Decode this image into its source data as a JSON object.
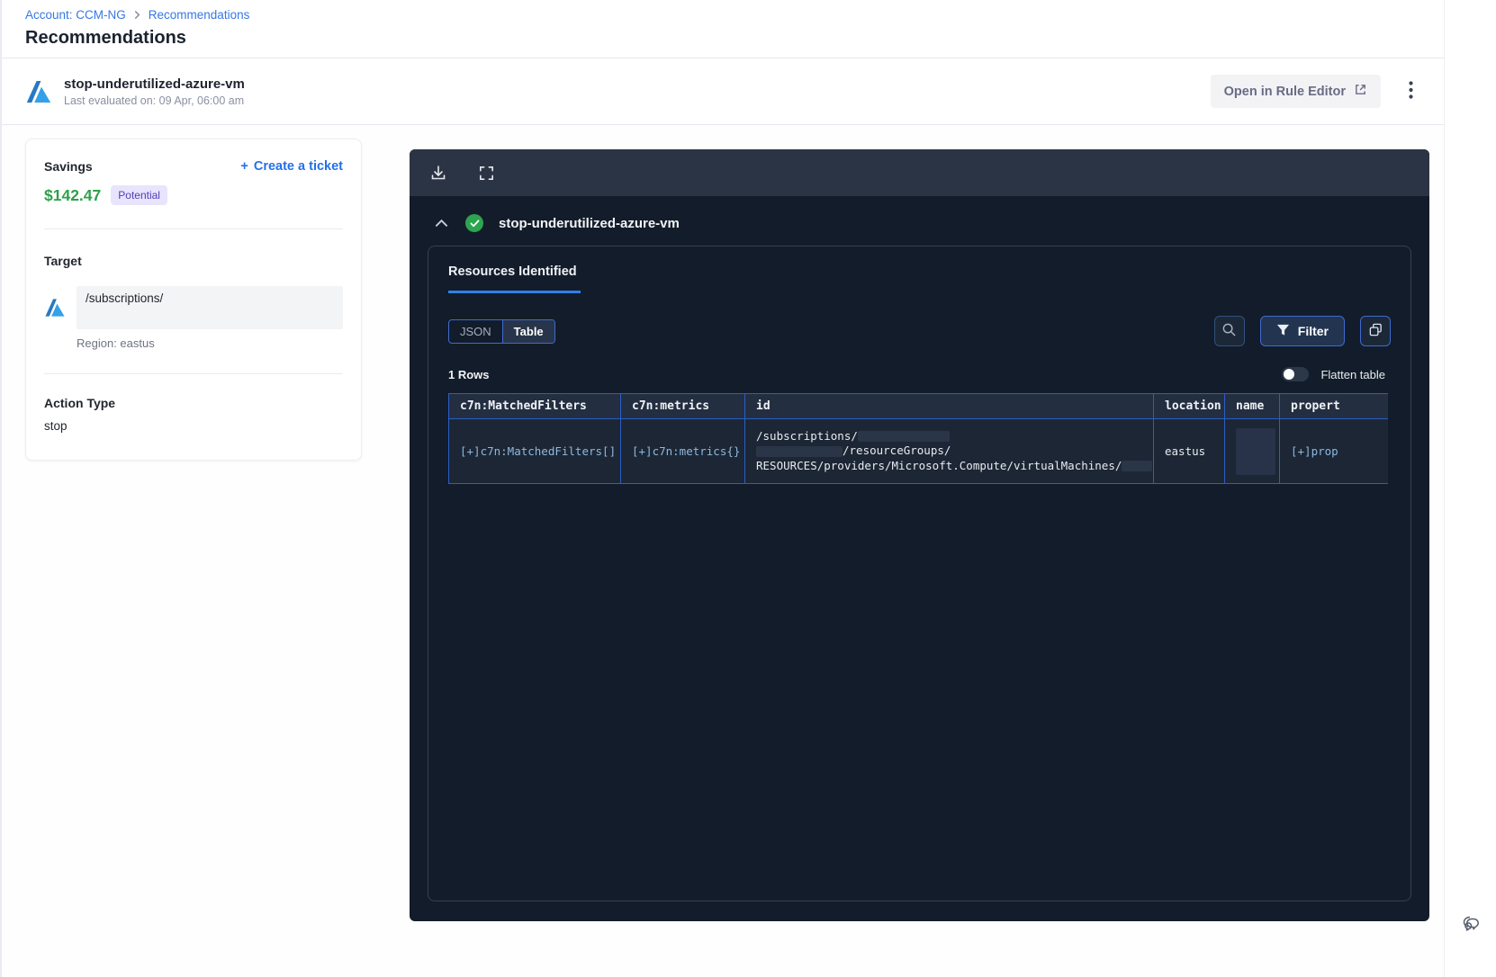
{
  "breadcrumb": {
    "account": "Account: CCM-NG",
    "separator": "›",
    "current": "Recommendations"
  },
  "page": {
    "title": "Recommendations"
  },
  "rule_header": {
    "name": "stop-underutilized-azure-vm",
    "last_evaluated": "Last evaluated on: 09 Apr, 06:00 am",
    "open_in_rule_editor": "Open in Rule Editor"
  },
  "savings_card": {
    "savings_label": "Savings",
    "amount": "$142.47",
    "badge": "Potential",
    "create_ticket": "Create a ticket",
    "plus_glyph": "+",
    "target_label": "Target",
    "target_path": "/subscriptions/",
    "region": "Region: eastus",
    "action_type_label": "Action Type",
    "action_type_value": "stop"
  },
  "viewer": {
    "section_title": "stop-underutilized-azure-vm",
    "tab_label": "Resources Identified",
    "view_toggle": {
      "json": "JSON",
      "table": "Table"
    },
    "filter_label": "Filter",
    "rows_count": "1 Rows",
    "flatten_label": "Flatten table",
    "table": {
      "columns": [
        "c7n:MatchedFilters",
        "c7n:metrics",
        "id",
        "location",
        "name",
        "propert"
      ],
      "row": {
        "matched_filters": "[+]c7n:MatchedFilters[]",
        "metrics": "[+]c7n:metrics{}",
        "id_lines": [
          "/subscriptions/",
          "/resourceGroups/",
          "RESOURCES/providers/Microsoft.Compute/virtualMachines/"
        ],
        "location": "eastus",
        "name": "",
        "properties": "[+]prop"
      }
    }
  },
  "colors": {
    "accent_blue": "#3577e5",
    "savings_green": "#2ea04a",
    "badge_bg": "#e9e4fd",
    "badge_text": "#5040b5",
    "card_dark": "#131c2a",
    "toolbar_dark": "#2b3444",
    "table_border": "#2b5fc5",
    "check_green": "#2da44f"
  }
}
